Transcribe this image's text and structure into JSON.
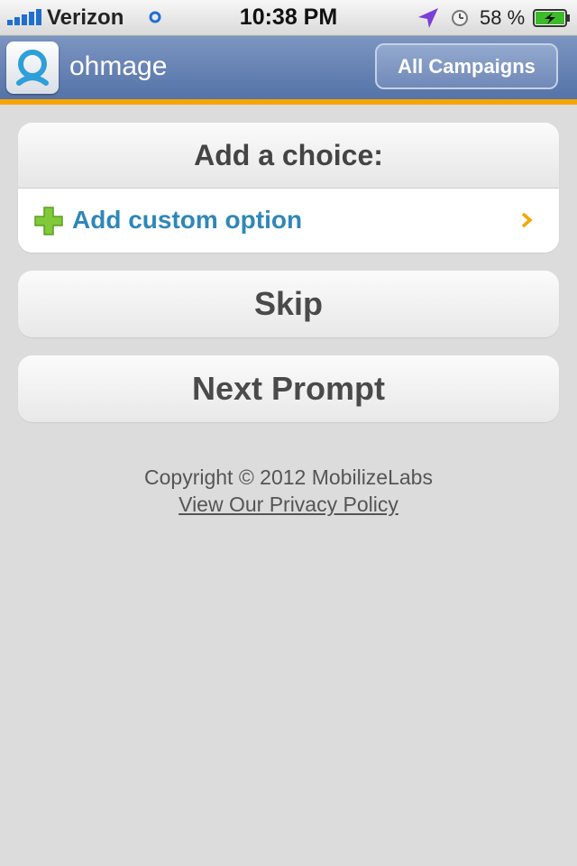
{
  "status_bar": {
    "carrier": "Verizon",
    "time": "10:38 PM",
    "battery_percent": "58 %",
    "battery_level": 0.58,
    "signal_bars": 5
  },
  "header": {
    "app_title": "ohmage",
    "campaigns_button": "All Campaigns",
    "accent_color": "#f6a500",
    "bar_color": "#5f7daf"
  },
  "choice": {
    "heading": "Add a choice:",
    "custom_option_label": "Add custom option"
  },
  "buttons": {
    "skip": "Skip",
    "next_prompt": "Next Prompt"
  },
  "footer": {
    "copyright": "Copyright © 2012 MobilizeLabs",
    "privacy_link": "View Our Privacy Policy"
  },
  "icons": [
    "signal-bars-icon",
    "wifi-icon",
    "location-arrow-icon",
    "alarm-clock-icon",
    "battery-icon",
    "ohmage-logo-icon",
    "plus-icon",
    "chevron-right-icon"
  ]
}
